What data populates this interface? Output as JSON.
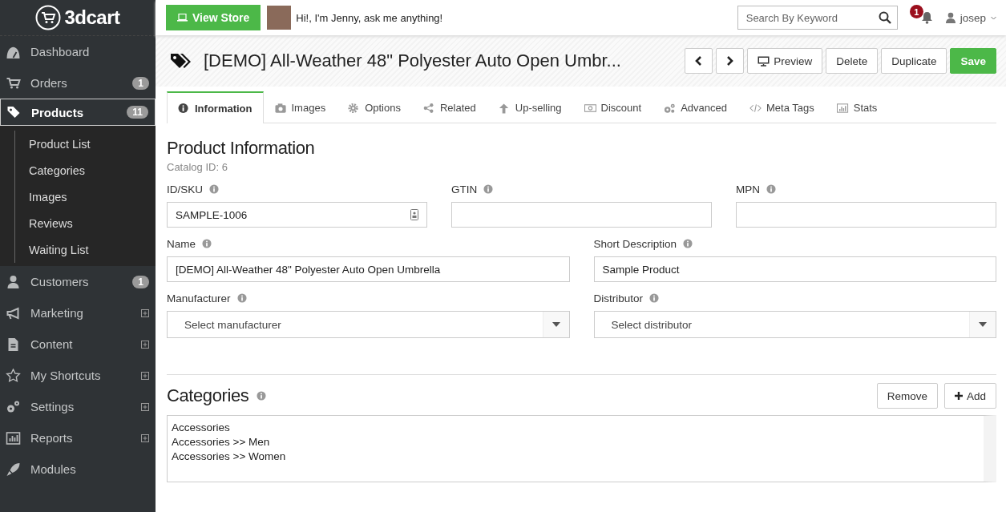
{
  "sidebar": {
    "logo": "3dcart",
    "items": [
      {
        "label": "Dashboard",
        "selected": false,
        "expandable": false
      },
      {
        "label": "Orders",
        "badge": "1",
        "selected": false,
        "expandable": false
      },
      {
        "label": "Products",
        "badge": "11",
        "selected": true,
        "expandable": false,
        "children": [
          {
            "label": "Product List"
          },
          {
            "label": "Categories"
          },
          {
            "label": "Images"
          },
          {
            "label": "Reviews"
          },
          {
            "label": "Waiting List"
          }
        ]
      },
      {
        "label": "Customers",
        "badge": "1",
        "selected": false,
        "expandable": false
      },
      {
        "label": "Marketing",
        "selected": false,
        "expandable": true
      },
      {
        "label": "Content",
        "selected": false,
        "expandable": true
      },
      {
        "label": "My Shortcuts",
        "selected": false,
        "expandable": true
      },
      {
        "label": "Settings",
        "selected": false,
        "expandable": true
      },
      {
        "label": "Reports",
        "selected": false,
        "expandable": true
      },
      {
        "label": "Modules",
        "selected": false,
        "expandable": false
      }
    ]
  },
  "topbar": {
    "view_store": "View Store",
    "assistant": "Hi!, I'm Jenny, ask me anything!",
    "search": {
      "placeholder": "Search By Keyword"
    },
    "notifications": "1",
    "user": "josep"
  },
  "header": {
    "title": "[DEMO] All-Weather 48\" Polyester Auto Open Umbr...",
    "buttons": [
      {
        "kind": "prev"
      },
      {
        "kind": "next"
      },
      {
        "kind": "preview",
        "label": "Preview"
      },
      {
        "kind": "plain",
        "label": "Delete"
      },
      {
        "kind": "plain",
        "label": "Duplicate"
      },
      {
        "kind": "primary",
        "label": "Save"
      }
    ]
  },
  "tabs": [
    {
      "label": "Information",
      "selected": true
    },
    {
      "label": "Images",
      "selected": false
    },
    {
      "label": "Options",
      "selected": false
    },
    {
      "label": "Related",
      "selected": false
    },
    {
      "label": "Up-selling",
      "selected": false
    },
    {
      "label": "Discount",
      "selected": false
    },
    {
      "label": "Advanced",
      "selected": false
    },
    {
      "label": "Meta Tags",
      "selected": false
    },
    {
      "label": "Stats",
      "selected": false
    }
  ],
  "product_information": {
    "title": "Product Information",
    "catalog_id": "Catalog ID: 6",
    "rows": [
      [
        {
          "label": "ID/SKU",
          "kind": "sku",
          "value": "SAMPLE-1006"
        },
        {
          "label": "GTIN",
          "kind": "text"
        },
        {
          "label": "MPN",
          "kind": "text"
        }
      ],
      [
        {
          "label": "Name",
          "kind": "text",
          "value": "[DEMO] All-Weather 48\" Polyester Auto Open Umbrella"
        },
        {
          "label": "Short Description",
          "kind": "text",
          "value": "Sample Product"
        }
      ],
      [
        {
          "label": "Manufacturer",
          "kind": "select",
          "placeholder": "Select manufacturer"
        },
        {
          "label": "Distributor",
          "kind": "select",
          "placeholder": "Select distributor"
        }
      ]
    ]
  },
  "categories": {
    "title": "Categories",
    "buttons": [
      {
        "kind": "plain",
        "label": "Remove"
      },
      {
        "kind": "add",
        "label": "Add"
      }
    ],
    "items": [
      "Accessories",
      "Accessories >> Men",
      "Accessories >> Women"
    ]
  }
}
